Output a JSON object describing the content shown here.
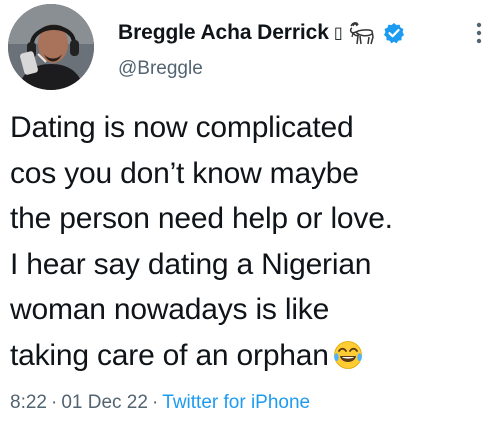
{
  "user": {
    "display_name": "Breggle Acha Derrick",
    "name_box_glyph": "▯",
    "handle": "@Breggle",
    "avatar_icon": "profile-photo-headphones",
    "badge_icons": [
      "goat-icon",
      "verified-icon"
    ],
    "verified_color": "#1d9bf0"
  },
  "tweet": {
    "lines": [
      "Dating is now complicated",
      "cos you don’t know maybe",
      "the person need help or love.",
      "I hear say dating a Nigerian",
      "woman nowadays is like",
      "taking care of an orphan"
    ],
    "emoji": "face-with-tears-of-joy"
  },
  "meta": {
    "time": "8:22",
    "separator": "·",
    "date": "01 Dec 22",
    "source": "Twitter for iPhone",
    "source_color": "#1d9bf0"
  },
  "colors": {
    "text": "#0f1419",
    "secondary": "#536471",
    "accent": "#1d9bf0"
  }
}
